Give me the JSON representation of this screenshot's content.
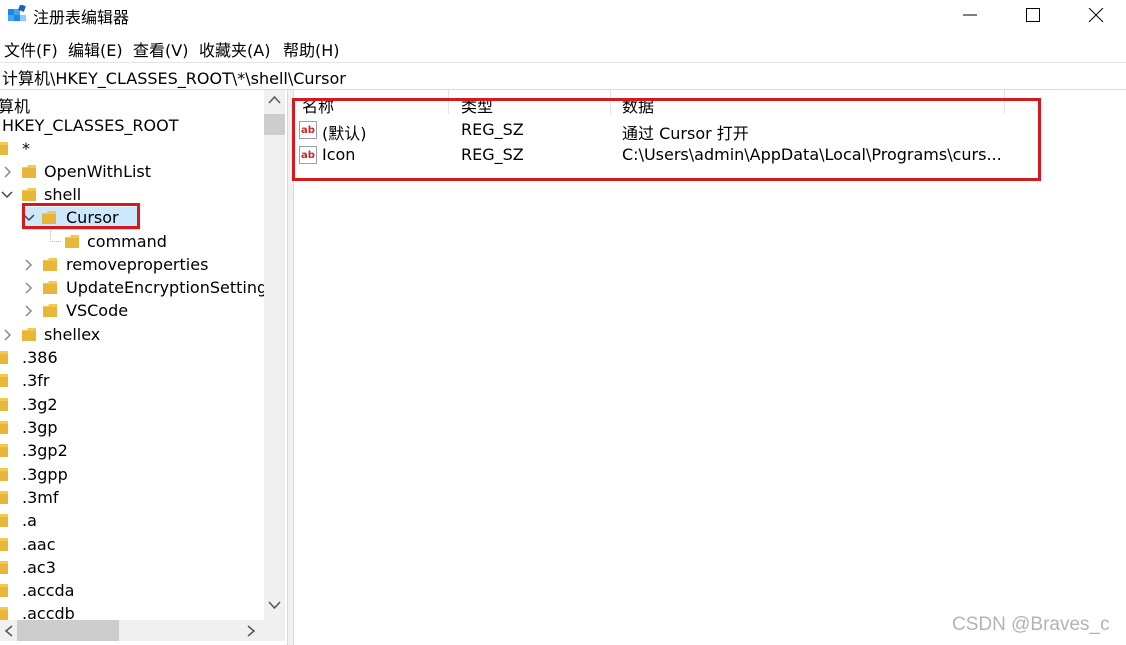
{
  "window": {
    "title": "注册表编辑器"
  },
  "menu": [
    "文件(F)",
    "编辑(E)",
    "查看(V)",
    "收藏夹(A)",
    "帮助(H)"
  ],
  "address": "计算机\\HKEY_CLASSES_ROOT\\*\\shell\\Cursor",
  "tree": {
    "computer": "算机",
    "root": "HKEY_CLASSES_ROOT",
    "star": "*",
    "open_with_list": "OpenWithList",
    "shell": "shell",
    "cursor": "Cursor",
    "command": "command",
    "removeproperties": "removeproperties",
    "update_encryption": "UpdateEncryptionSetting",
    "vscode": "VSCode",
    "shellex": "shellex",
    "ext_386": ".386",
    "ext_3fr": ".3fr",
    "ext_3g2": ".3g2",
    "ext_3gp": ".3gp",
    "ext_3gp2": ".3gp2",
    "ext_3gpp": ".3gpp",
    "ext_3mf": ".3mf",
    "ext_a": ".a",
    "ext_aac": ".aac",
    "ext_ac3": ".ac3",
    "ext_accda": ".accda",
    "ext_accdb": ".accdb"
  },
  "values": {
    "columns": [
      "名称",
      "类型",
      "数据"
    ],
    "rows": [
      {
        "name": "(默认)",
        "type": "REG_SZ",
        "data": "通过 Cursor 打开"
      },
      {
        "name": "Icon",
        "type": "REG_SZ",
        "data": "C:\\Users\\admin\\AppData\\Local\\Programs\\curs..."
      }
    ]
  },
  "watermark": "CSDN @Braves_c",
  "colors": {
    "highlight": "#d6191d",
    "selection": "#cce8ff",
    "folder": "#f5c94c"
  }
}
